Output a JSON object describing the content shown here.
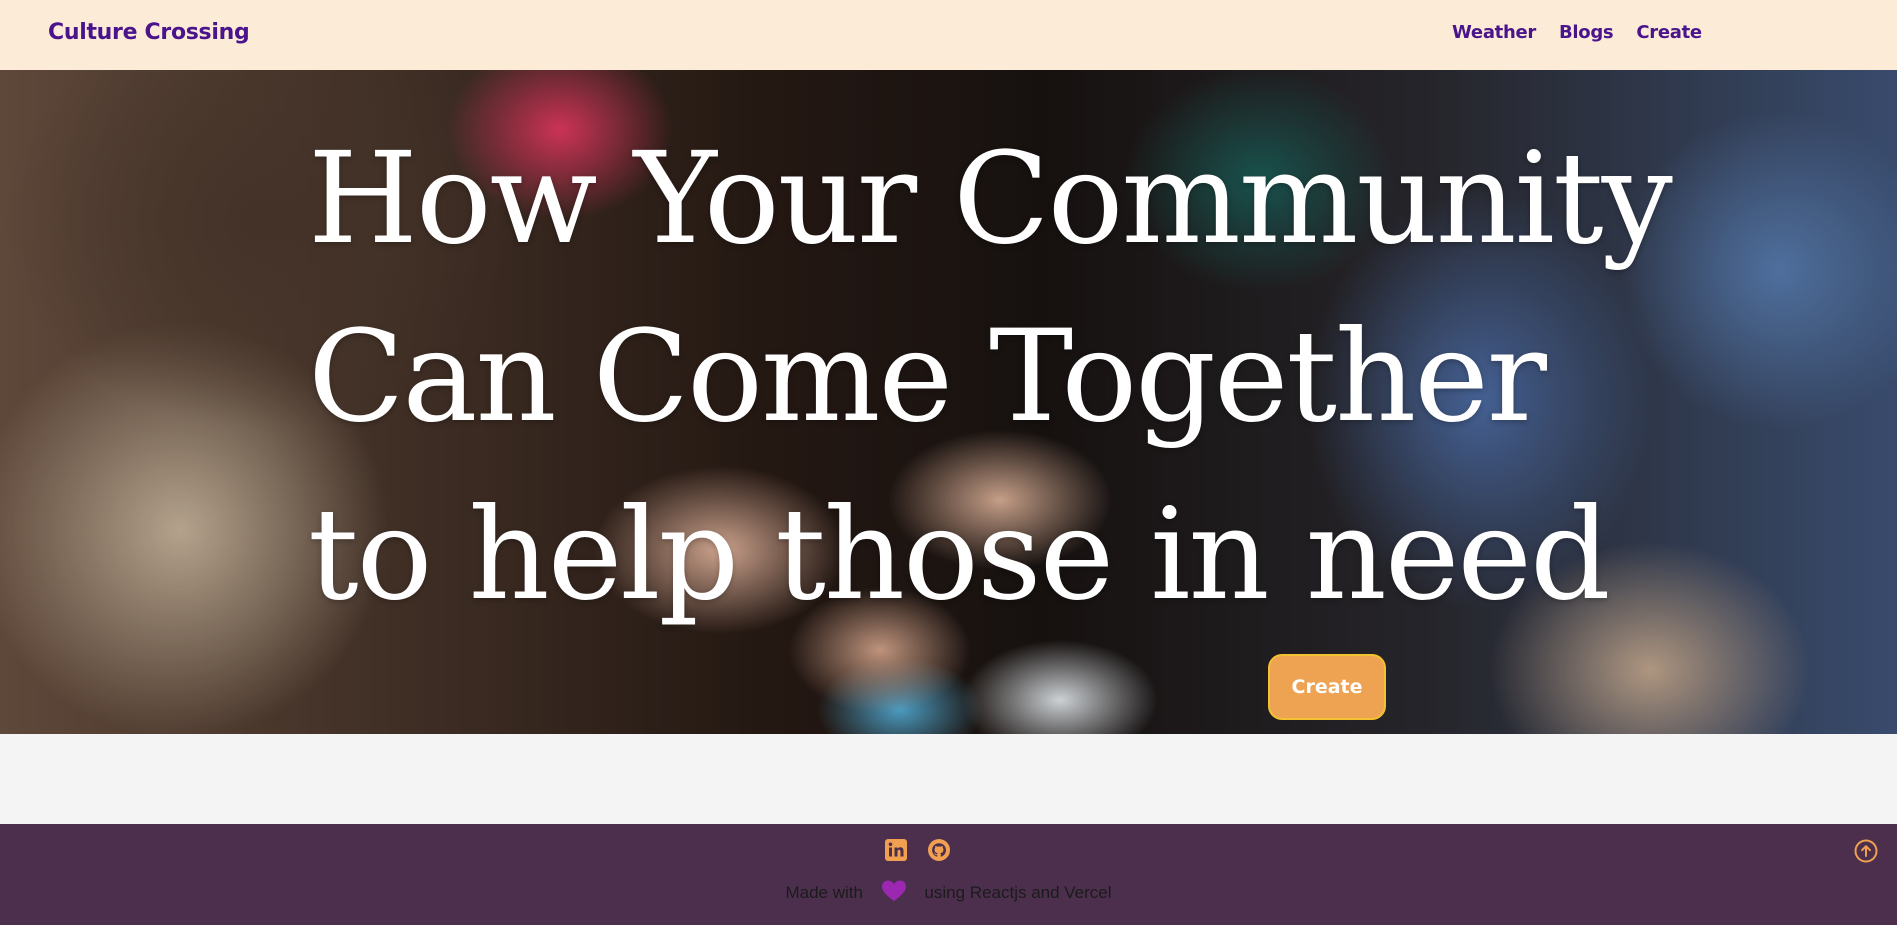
{
  "navbar": {
    "brand": "Culture Crossing",
    "links": [
      {
        "label": "Weather"
      },
      {
        "label": "Blogs"
      },
      {
        "label": "Create"
      }
    ]
  },
  "hero": {
    "title_lines": [
      "How Your Community",
      "Can Come Together",
      "to help those in need"
    ],
    "button_label": "Create",
    "background": "photo of hands stacked together in colorful knit sweaters"
  },
  "footer": {
    "icons": [
      "linkedin-icon",
      "github-icon",
      "heart-icon",
      "arrow-up-circle-icon"
    ],
    "made_with_prefix": "Made with",
    "made_with_suffix": "using Reactjs and Vercel"
  },
  "colors": {
    "navbar_bg": "#fbebd7",
    "brand": "#4a148c",
    "button_bg": "#eea353",
    "button_border": "#f2c230",
    "footer_bg": "#4b2f4d",
    "footer_icon": "#f0a050",
    "heart": "#9c27b0"
  }
}
